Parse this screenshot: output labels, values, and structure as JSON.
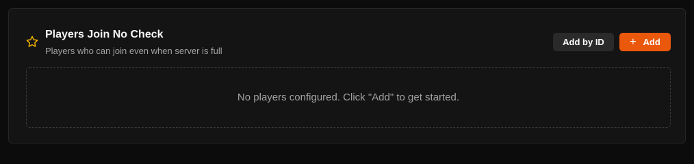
{
  "section": {
    "title": "Players Join No Check",
    "subtitle": "Players who can join even when server is full",
    "icon": "star-icon"
  },
  "actions": {
    "add_by_id_label": "Add by ID",
    "add_label": "Add",
    "add_icon": "plus-icon"
  },
  "empty_state": {
    "message": "No players configured. Click \"Add\" to get started."
  },
  "colors": {
    "accent": "#ea580c",
    "star": "#f5b400",
    "background": "#0c0c0c",
    "card": "#141414"
  }
}
